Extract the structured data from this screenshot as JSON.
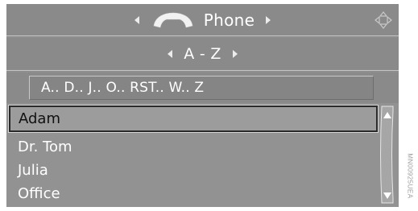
{
  "header": {
    "title": "Phone",
    "icon": "handset-icon",
    "nav_icon": "direction-controller-icon"
  },
  "sort": {
    "label": "A - Z"
  },
  "index_bar": {
    "text": "A.. D.. J.. O.. RST.. W.. Z"
  },
  "contacts": {
    "selected": "Adam",
    "items": [
      "Dr. Tom",
      "Julia",
      "Office"
    ]
  },
  "figure_code": "MN00925UEA",
  "colors": {
    "background": "#8e8e8e",
    "text": "#ffffff",
    "selection_border": "#2a2a2a"
  }
}
